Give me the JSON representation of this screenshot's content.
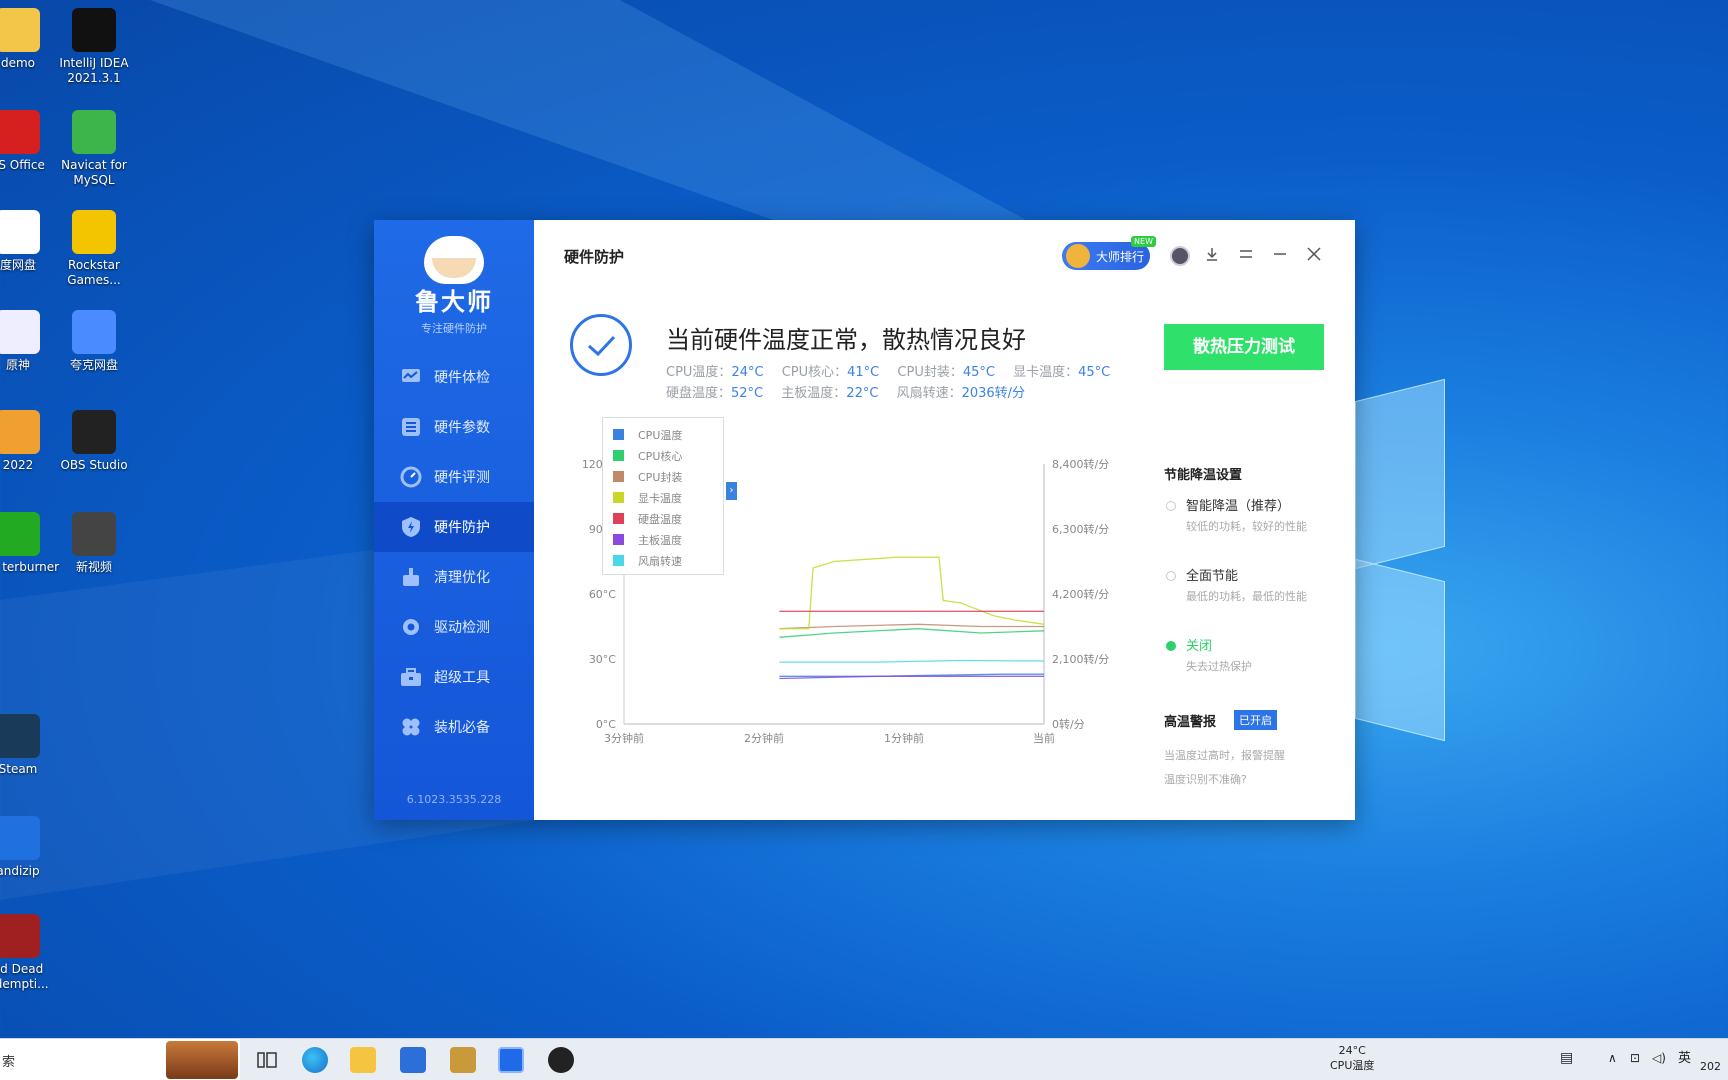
{
  "desktop": {
    "icons": [
      {
        "label": "demo",
        "name": "desktop-icon-demo"
      },
      {
        "label": "IntelliJ IDEA 2021.3.1",
        "name": "desktop-icon-intellij"
      },
      {
        "label": "PS Office",
        "name": "desktop-icon-wps"
      },
      {
        "label": "Navicat for MySQL",
        "name": "desktop-icon-navicat"
      },
      {
        "label": "度网盘",
        "name": "desktop-icon-baidu-pan"
      },
      {
        "label": "Rockstar Games...",
        "name": "desktop-icon-rockstar"
      },
      {
        "label": "原神",
        "name": "desktop-icon-genshin"
      },
      {
        "label": "夸克网盘",
        "name": "desktop-icon-quark"
      },
      {
        "label": "2022",
        "name": "desktop-icon-game-2022"
      },
      {
        "label": "OBS Studio",
        "name": "desktop-icon-obs"
      },
      {
        "label": "MSI terburner",
        "name": "desktop-icon-msi"
      },
      {
        "label": "新视频",
        "name": "desktop-icon-new-video"
      },
      {
        "label": "Steam",
        "name": "desktop-icon-steam"
      },
      {
        "label": "andizip",
        "name": "desktop-icon-bandizip"
      },
      {
        "label": "ed Dead edempti...",
        "name": "desktop-icon-rdr"
      }
    ]
  },
  "app": {
    "brand": "鲁大师",
    "brand_sub": "专注硬件防护",
    "nav": [
      {
        "label": "硬件体检"
      },
      {
        "label": "硬件参数"
      },
      {
        "label": "硬件评测"
      },
      {
        "label": "硬件防护"
      },
      {
        "label": "清理优化"
      },
      {
        "label": "驱动检测"
      },
      {
        "label": "超级工具"
      },
      {
        "label": "装机必备"
      }
    ],
    "version": "6.1023.3535.228",
    "title": "硬件防护",
    "rank_badge": "大师排行",
    "rank_new": "NEW",
    "status": {
      "title": "当前硬件温度正常，散热情况良好",
      "metrics_row1": [
        {
          "label": "CPU温度：",
          "value": "24°C"
        },
        {
          "label": "CPU核心：",
          "value": "41°C"
        },
        {
          "label": "CPU封装：",
          "value": "45°C"
        },
        {
          "label": "显卡温度：",
          "value": "45°C"
        }
      ],
      "metrics_row2": [
        {
          "label": "硬盘温度：",
          "value": "52°C"
        },
        {
          "label": "主板温度：",
          "value": "22°C"
        },
        {
          "label": "风扇转速：",
          "value": "2036转/分"
        }
      ]
    },
    "stress_button": "散热压力测试",
    "settings": {
      "title": "节能降温设置",
      "options": [
        {
          "label": "智能降温（推荐）",
          "desc": "较低的功耗，较好的性能",
          "selected": false
        },
        {
          "label": "全面节能",
          "desc": "最低的功耗，最低的性能",
          "selected": false
        },
        {
          "label": "关闭",
          "desc": "失去过热保护",
          "selected": true
        }
      ],
      "alert_label": "高温警报",
      "alert_state": "已开启",
      "alert_desc1": "当温度过高时，报警提醒",
      "alert_desc2": "温度识别不准确?"
    }
  },
  "chart_data": {
    "type": "line",
    "x_ticks": [
      "3分钟前",
      "2分钟前",
      "1分钟前",
      "当前"
    ],
    "y_ticks_left": [
      "0°C",
      "30°C",
      "60°C",
      "90°C",
      "120°C"
    ],
    "y_ticks_right": [
      "0转/分",
      "2,100转/分",
      "4,200转/分",
      "6,300转/分",
      "8,400转/分"
    ],
    "ylim_left": [
      0,
      120
    ],
    "ylim_right": [
      0,
      8400
    ],
    "legend_placement": "top-left",
    "series": [
      {
        "name": "CPU温度",
        "color": "#3b82e0",
        "axis": "left",
        "start": 0.37,
        "points": [
          [
            0.37,
            22
          ],
          [
            0.6,
            22
          ],
          [
            0.9,
            23
          ],
          [
            1.0,
            23
          ]
        ]
      },
      {
        "name": "CPU核心",
        "color": "#2fcf6e",
        "axis": "left",
        "start": 0.37,
        "points": [
          [
            0.37,
            40
          ],
          [
            0.5,
            42
          ],
          [
            0.7,
            44
          ],
          [
            0.85,
            42
          ],
          [
            1.0,
            43
          ]
        ]
      },
      {
        "name": "CPU封装",
        "color": "#c08a6a",
        "axis": "left",
        "start": 0.37,
        "points": [
          [
            0.37,
            44
          ],
          [
            0.5,
            45
          ],
          [
            0.7,
            46
          ],
          [
            0.85,
            45
          ],
          [
            1.0,
            45
          ]
        ]
      },
      {
        "name": "显卡温度",
        "color": "#c8d82a",
        "axis": "left",
        "start": 0.37,
        "points": [
          [
            0.37,
            44
          ],
          [
            0.44,
            44
          ],
          [
            0.45,
            72
          ],
          [
            0.5,
            75
          ],
          [
            0.65,
            77
          ],
          [
            0.75,
            77
          ],
          [
            0.76,
            57
          ],
          [
            0.8,
            56
          ],
          [
            0.88,
            50
          ],
          [
            0.93,
            48
          ],
          [
            1.0,
            46
          ]
        ]
      },
      {
        "name": "硬盘温度",
        "color": "#e0405a",
        "axis": "left",
        "start": 0.37,
        "points": [
          [
            0.37,
            52
          ],
          [
            0.6,
            52
          ],
          [
            0.8,
            52
          ],
          [
            1.0,
            52
          ]
        ]
      },
      {
        "name": "主板温度",
        "color": "#8a4ae0",
        "axis": "left",
        "start": 0.37,
        "points": [
          [
            0.37,
            21
          ],
          [
            0.6,
            22
          ],
          [
            1.0,
            22
          ]
        ]
      },
      {
        "name": "风扇转速",
        "color": "#4ad8e6",
        "axis": "right",
        "start": 0.37,
        "points": [
          [
            0.37,
            2000
          ],
          [
            0.6,
            2000
          ],
          [
            0.8,
            2050
          ],
          [
            1.0,
            2036
          ]
        ]
      }
    ]
  },
  "taskbar": {
    "search_text": "索",
    "cpu_temp": "24°C",
    "cpu_label": "CPU温度",
    "ime": "英",
    "clock_partial": "202"
  }
}
